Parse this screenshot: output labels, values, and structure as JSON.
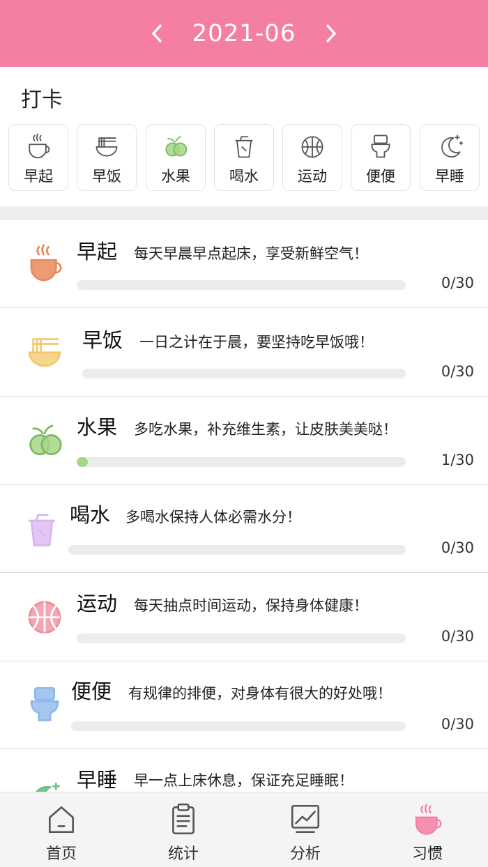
{
  "header": {
    "month": "2021-06"
  },
  "checkin": {
    "title": "打卡",
    "chips": [
      {
        "label": "早起",
        "icon": "coffee-cup-icon"
      },
      {
        "label": "早饭",
        "icon": "noodle-bowl-icon"
      },
      {
        "label": "水果",
        "icon": "fruit-icon"
      },
      {
        "label": "喝水",
        "icon": "drink-cup-icon"
      },
      {
        "label": "运动",
        "icon": "ball-icon"
      },
      {
        "label": "便便",
        "icon": "toilet-icon"
      },
      {
        "label": "早睡",
        "icon": "moon-icon"
      }
    ]
  },
  "habits": [
    {
      "name": "早起",
      "desc": "每天早晨早点起床，享受新鲜空气！",
      "count": "0/30",
      "progress": 0,
      "color": "#e98a5b",
      "icon": "coffee-cup-icon"
    },
    {
      "name": "早饭",
      "desc": "一日之计在于晨，要坚持吃早饭哦！",
      "count": "0/30",
      "progress": 0,
      "color": "#f3c86a",
      "icon": "noodle-bowl-icon"
    },
    {
      "name": "水果",
      "desc": "多吃水果，补充维生素，让皮肤美美哒！",
      "count": "1/30",
      "progress": 0.033,
      "color": "#a6d68a",
      "icon": "fruit-icon"
    },
    {
      "name": "喝水",
      "desc": "多喝水保持人体必需水分！",
      "count": "0/30",
      "progress": 0,
      "color": "#d8b4f0",
      "icon": "drink-cup-icon"
    },
    {
      "name": "运动",
      "desc": "每天抽点时间运动，保持身体健康！",
      "count": "0/30",
      "progress": 0,
      "color": "#f08a9a",
      "icon": "ball-icon"
    },
    {
      "name": "便便",
      "desc": "有规律的排便，对身体有很大的好处哦！",
      "count": "0/30",
      "progress": 0,
      "color": "#8fb8ea",
      "icon": "toilet-icon"
    },
    {
      "name": "早睡",
      "desc": "早一点上床休息，保证充足睡眠！",
      "count": "",
      "progress": 0,
      "color": "#6cc08a",
      "icon": "moon-icon"
    }
  ],
  "tabs": [
    {
      "label": "首页",
      "icon": "home-icon",
      "active": false
    },
    {
      "label": "统计",
      "icon": "clipboard-icon",
      "active": false
    },
    {
      "label": "分析",
      "icon": "chart-icon",
      "active": false
    },
    {
      "label": "习惯",
      "icon": "coffee-cup-icon",
      "active": true
    }
  ],
  "colors": {
    "header": "#f47fa1",
    "active_tab": "#f47fa1"
  }
}
